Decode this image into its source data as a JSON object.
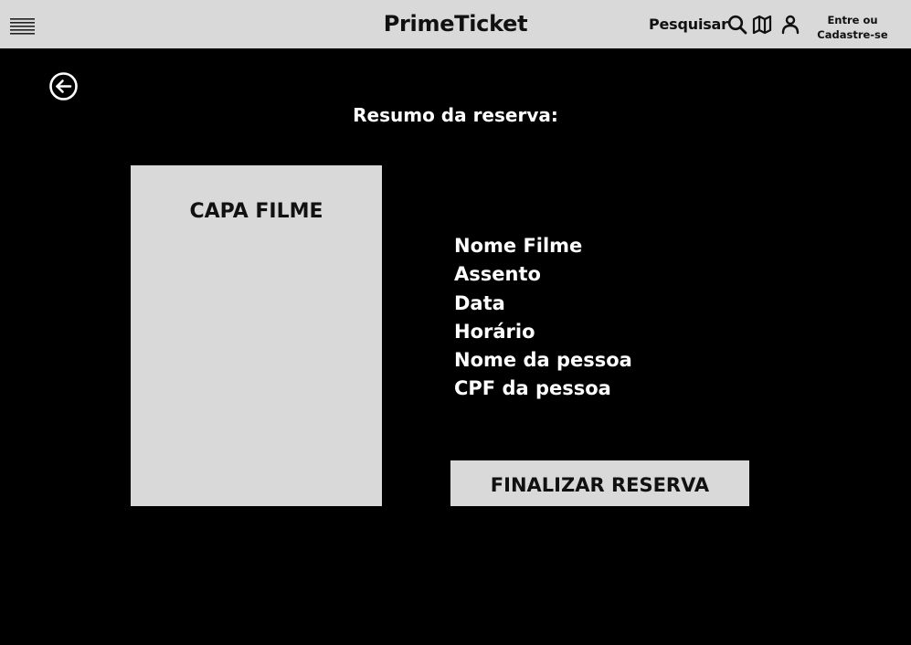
{
  "header": {
    "brand": "PrimeTicket",
    "search_label": "Pesquisar",
    "signin_line1": "Entre ou",
    "signin_line2": "Cadastre-se",
    "icons": [
      "menu-icon",
      "search-icon",
      "map-icon",
      "user-icon"
    ]
  },
  "main": {
    "back_icon": "arrow-left-circle-icon",
    "title": "Resumo da reserva:",
    "poster_label": "CAPA FILME",
    "details": [
      "Nome Filme",
      "Assento",
      "Data",
      "Horário",
      "Nome da pessoa",
      "CPF da pessoa"
    ],
    "finalize_label": "FINALIZAR RESERVA"
  },
  "colors": {
    "background": "#000000",
    "topbar": "#d9d9d9",
    "panel": "#d9d9d9",
    "text_light": "#ffffff",
    "text_dark": "#111111"
  }
}
